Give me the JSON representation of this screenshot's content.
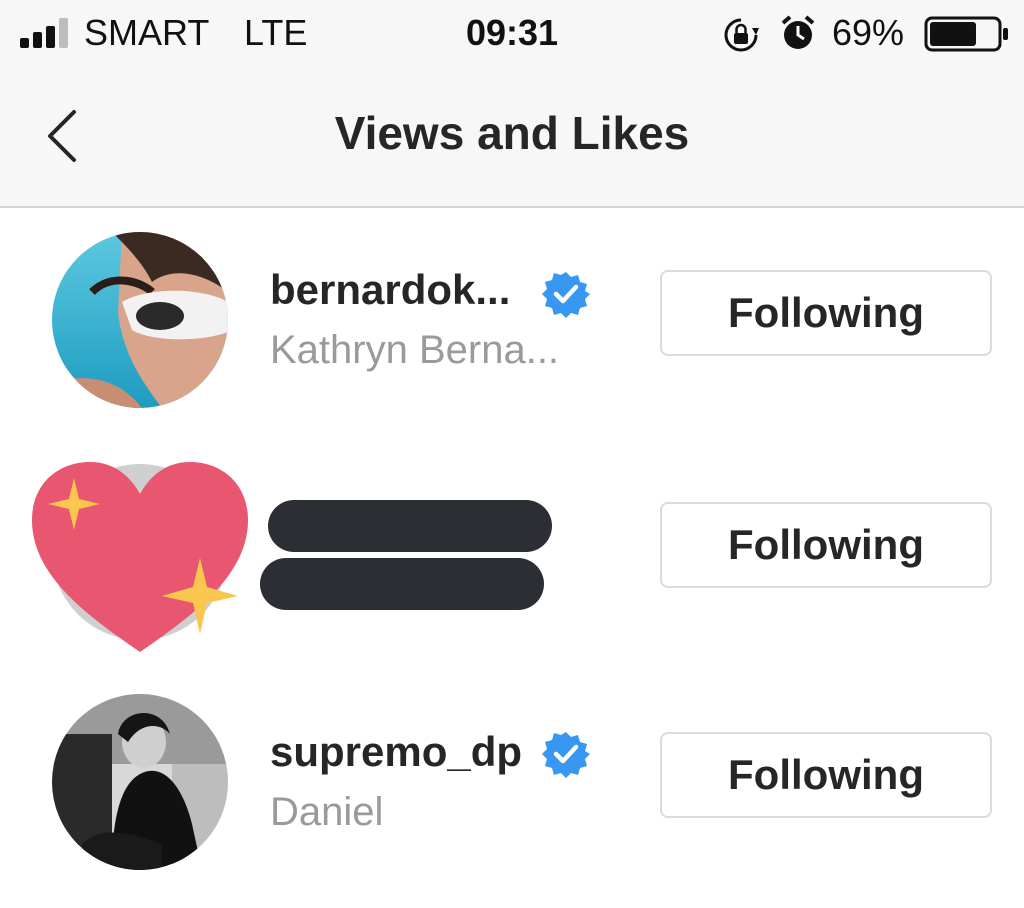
{
  "status_bar": {
    "carrier": "SMART",
    "network": "LTE",
    "time": "09:31",
    "battery_percent": "69%",
    "battery_level": 0.69,
    "icons": [
      "signal-icon",
      "orientation-lock-icon",
      "alarm-icon",
      "battery-icon"
    ]
  },
  "header": {
    "title": "Views and Likes",
    "back_icon": "chevron-left-icon"
  },
  "users": [
    {
      "username": "bernardok...",
      "full_name": "Kathryn Berna...",
      "verified": true,
      "button_label": "Following"
    },
    {
      "username": "",
      "full_name": "",
      "verified": false,
      "redacted": true,
      "sticker": "sparkling-heart-icon",
      "button_label": "Following"
    },
    {
      "username": "supremo_dp",
      "full_name": "Daniel",
      "verified": true,
      "button_label": "Following"
    }
  ],
  "colors": {
    "verified_badge": "#3897f0",
    "heart": "#e8566f",
    "sparkle": "#f9c74f",
    "redaction": "#2b2e33"
  }
}
